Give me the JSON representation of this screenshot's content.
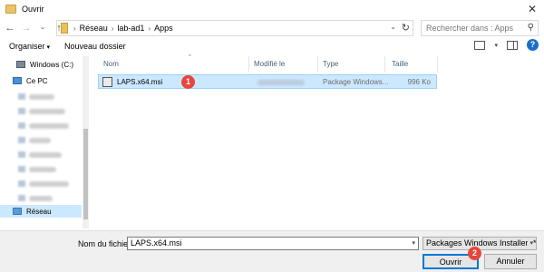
{
  "window": {
    "title": "Ouvrir"
  },
  "address": {
    "segments": [
      "Réseau",
      "lab-ad1",
      "Apps"
    ]
  },
  "search": {
    "placeholder": "Rechercher dans : Apps"
  },
  "toolbar": {
    "organize_label": "Organiser",
    "new_folder_label": "Nouveau dossier",
    "help_label": "?"
  },
  "sidebar": {
    "items": [
      {
        "label": "Windows (C:)",
        "icon": "drive-icon"
      },
      {
        "label": "Ce PC",
        "icon": "computer-icon"
      },
      {
        "label": "Réseau",
        "icon": "network-icon",
        "selected": true
      }
    ]
  },
  "columns": {
    "name": "Nom",
    "modified": "Modifié le",
    "type": "Type",
    "size": "Taille"
  },
  "files": [
    {
      "name": "LAPS.x64.msi",
      "type": "Package Windows...",
      "size": "996 Ko",
      "icon": "msi-package-icon",
      "selected": true
    }
  ],
  "annotations": {
    "marker1": "1",
    "marker2": "2"
  },
  "footer": {
    "filename_label": "Nom du fichier :",
    "filename_value": "LAPS.x64.msi",
    "filetype_value": "Packages Windows Installer (*.msi)",
    "open_label": "Ouvrir",
    "cancel_label": "Annuler"
  },
  "colors": {
    "selection": "#cce8ff",
    "marker": "#e8453c",
    "accent": "#0078d7"
  }
}
